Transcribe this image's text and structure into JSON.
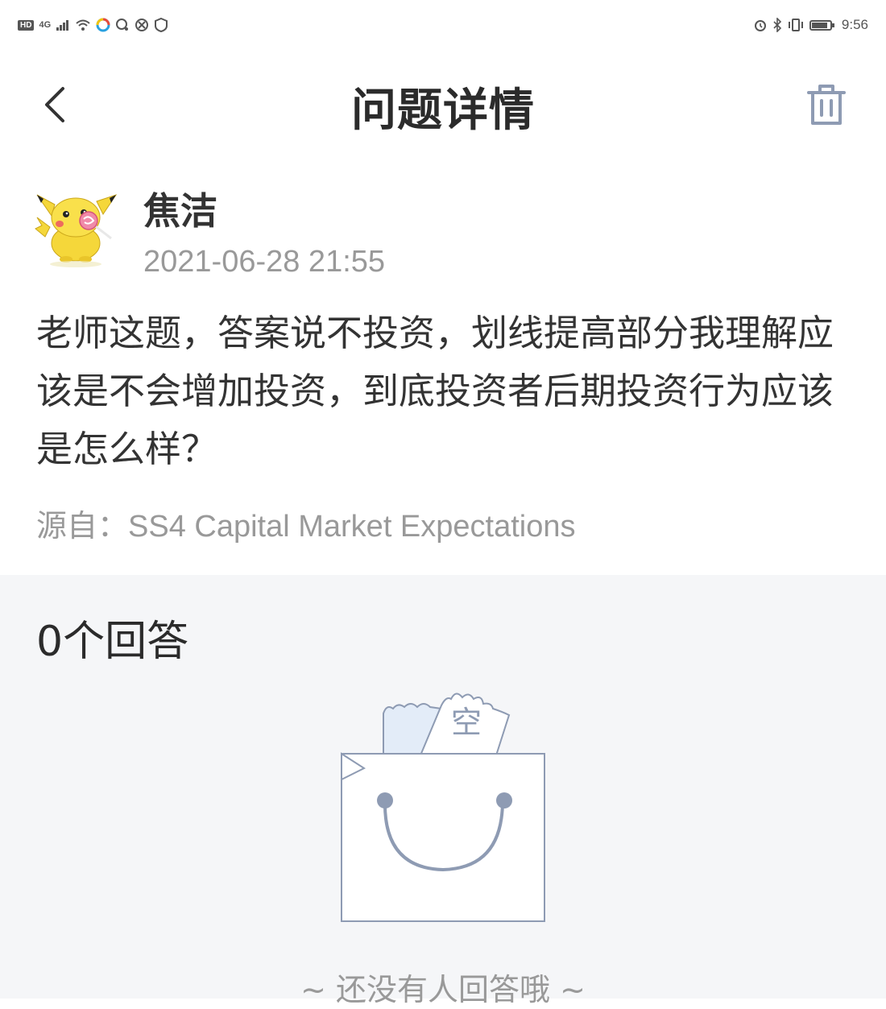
{
  "status_bar": {
    "left_badge": "HD",
    "network": "4G",
    "time": "9:56"
  },
  "header": {
    "title": "问题详情",
    "back_icon": "chevron-left-icon",
    "delete_icon": "trash-icon"
  },
  "question": {
    "author": "焦洁",
    "time": "2021-06-28 21:55",
    "text": "老师这题，答案说不投资，划线提高部分我理解应该是不会增加投资，到底投资者后期投资行为应该是怎么样？",
    "source_label": "源自：",
    "source_value": "SS4 Capital Market Expectations"
  },
  "answers": {
    "count_label": "0个回答",
    "empty_icon_text": "空",
    "empty_message": "~ 还没有人回答哦 ~"
  },
  "colors": {
    "icon_blue_gray": "#8e9bb3",
    "illustration_fill": "#e3ecf8",
    "section_bg": "#f5f6f8"
  }
}
